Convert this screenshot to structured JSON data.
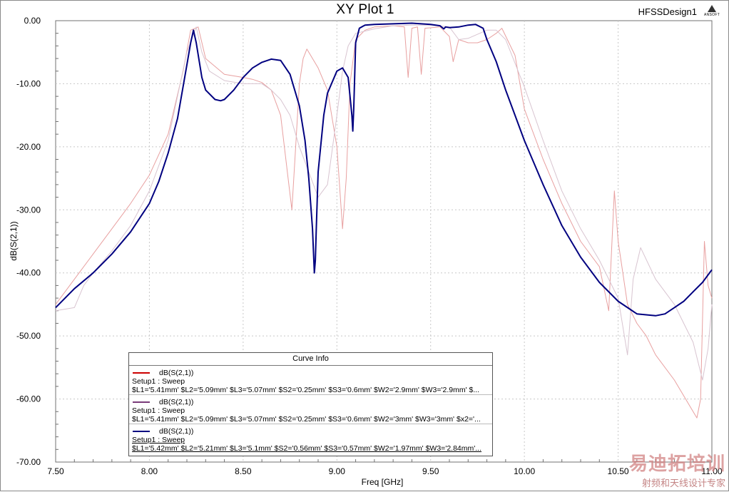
{
  "window": {
    "title": "XY Plot 1",
    "design_name": "HFSSDesign1",
    "logo_text": "ANSOFT"
  },
  "chart_data": {
    "type": "line",
    "title": "XY Plot 1",
    "xlabel": "Freq [GHz]",
    "ylabel": "dB(S(2,1))",
    "xlim": [
      7.5,
      11.0
    ],
    "ylim": [
      -70,
      0
    ],
    "x_ticks": [
      "7.50",
      "8.00",
      "8.50",
      "9.00",
      "9.50",
      "10.00",
      "10.50",
      "11.00"
    ],
    "y_ticks": [
      "0.00",
      "-10.00",
      "-20.00",
      "-30.00",
      "-40.00",
      "-50.00",
      "-60.00",
      "-70.00"
    ],
    "grid": true,
    "legend_title": "Curve Info",
    "legend_placement": "bottom-left",
    "series": [
      {
        "name": "dB(S(2,1))",
        "setup": "Setup1 : Sweep",
        "params": "$L1='5.41mm' $L2='5.09mm' $L3='5.07mm' $S2='0.25mm' $S3='0.6mm' $W2='2.9mm' $W3='2.9mm' $...",
        "color": "#e8a0a0",
        "legend_color": "#cc0000",
        "x": [
          7.5,
          7.6,
          7.7,
          7.8,
          7.9,
          8.0,
          8.1,
          8.18,
          8.22,
          8.26,
          8.3,
          8.4,
          8.5,
          8.55,
          8.6,
          8.65,
          8.7,
          8.74,
          8.76,
          8.78,
          8.8,
          8.82,
          8.84,
          8.86,
          8.9,
          8.95,
          9.0,
          9.03,
          9.05,
          9.07,
          9.1,
          9.15,
          9.2,
          9.3,
          9.36,
          9.38,
          9.4,
          9.43,
          9.45,
          9.47,
          9.55,
          9.6,
          9.62,
          9.65,
          9.7,
          9.75,
          9.8,
          9.85,
          9.88,
          9.95,
          10.0,
          10.1,
          10.2,
          10.3,
          10.4,
          10.45,
          10.48,
          10.5,
          10.55,
          10.6,
          10.65,
          10.7,
          10.8,
          10.9,
          10.92,
          10.94,
          10.96,
          10.98,
          11.0
        ],
        "y": [
          -45.0,
          -41.0,
          -37.0,
          -33.0,
          -29.0,
          -24.5,
          -18.0,
          -8.0,
          -1.5,
          -1.0,
          -6.0,
          -8.5,
          -9.0,
          -9.3,
          -9.8,
          -11.0,
          -15.0,
          -25.0,
          -30.0,
          -20.0,
          -10.0,
          -6.0,
          -4.5,
          -5.5,
          -7.5,
          -11.0,
          -20.0,
          -33.0,
          -25.0,
          -10.0,
          -3.0,
          -1.5,
          -1.0,
          -0.8,
          -1.0,
          -9.0,
          -1.2,
          -1.0,
          -8.5,
          -1.2,
          -1.0,
          -2.5,
          -6.5,
          -3.0,
          -3.5,
          -3.5,
          -3.0,
          -2.0,
          -1.2,
          -5.5,
          -14.0,
          -22.0,
          -29.0,
          -35.0,
          -39.0,
          -46.0,
          -27.0,
          -35.0,
          -45.0,
          -48.0,
          -50.0,
          -53.0,
          -57.0,
          -62.0,
          -63.0,
          -60.0,
          -35.0,
          -42.0,
          -44.0
        ]
      },
      {
        "name": "dB(S(2,1))",
        "setup": "Setup1 : Sweep",
        "params": "$L1='5.41mm' $L2='5.09mm' $L3='5.07mm' $S2='0.25mm' $S3='0.6mm' $W2='3mm' $W3='3mm' $x2='...",
        "color": "#d8c4d0",
        "legend_color": "#7a3b7a",
        "x": [
          7.5,
          7.6,
          7.65,
          7.7,
          7.8,
          7.9,
          8.0,
          8.1,
          8.2,
          8.25,
          8.28,
          8.32,
          8.4,
          8.5,
          8.6,
          8.65,
          8.7,
          8.75,
          8.8,
          8.85,
          8.9,
          8.95,
          9.0,
          9.03,
          9.06,
          9.1,
          9.2,
          9.3,
          9.4,
          9.5,
          9.6,
          9.65,
          9.7,
          9.8,
          9.85,
          9.9,
          10.0,
          10.1,
          10.2,
          10.3,
          10.4,
          10.5,
          10.55,
          10.58,
          10.62,
          10.7,
          10.8,
          10.9,
          10.95,
          10.98,
          11.0
        ],
        "y": [
          -46.0,
          -45.5,
          -42.0,
          -40.0,
          -36.5,
          -32.5,
          -27.0,
          -19.0,
          -5.0,
          -1.0,
          -5.0,
          -8.0,
          -9.5,
          -10.0,
          -10.0,
          -11.0,
          -12.5,
          -15.0,
          -20.0,
          -24.0,
          -28.0,
          -26.0,
          -15.0,
          -8.0,
          -4.0,
          -2.0,
          -1.3,
          -0.8,
          -0.7,
          -0.7,
          -1.0,
          -3.0,
          -2.8,
          -1.5,
          -1.5,
          -3.0,
          -10.5,
          -19.0,
          -27.0,
          -33.0,
          -38.0,
          -44.0,
          -53.0,
          -41.0,
          -36.0,
          -41.0,
          -45.0,
          -51.0,
          -57.0,
          -52.0,
          -45.0
        ]
      },
      {
        "name": "dB(S(2,1))",
        "setup": "Setup1 : Sweep",
        "params": "$L1='5.42mm' $L2='5.21mm' $L3='5.1mm' $S2='0.56mm' $S3='0.57mm' $W2='1.97mm' $W3='2.84mm'...",
        "color": "#000080",
        "legend_color": "#000080",
        "x": [
          7.5,
          7.6,
          7.7,
          7.8,
          7.9,
          8.0,
          8.05,
          8.1,
          8.15,
          8.2,
          8.22,
          8.235,
          8.25,
          8.28,
          8.3,
          8.35,
          8.38,
          8.4,
          8.45,
          8.5,
          8.55,
          8.6,
          8.65,
          8.7,
          8.75,
          8.8,
          8.83,
          8.85,
          8.87,
          8.88,
          8.885,
          8.89,
          8.9,
          8.93,
          8.95,
          9.0,
          9.03,
          9.06,
          9.08,
          9.085,
          9.09,
          9.1,
          9.12,
          9.15,
          9.2,
          9.3,
          9.4,
          9.5,
          9.55,
          9.57,
          9.58,
          9.6,
          9.65,
          9.7,
          9.74,
          9.78,
          9.8,
          9.85,
          9.9,
          9.95,
          10.0,
          10.1,
          10.2,
          10.3,
          10.4,
          10.5,
          10.6,
          10.7,
          10.75,
          10.8,
          10.85,
          10.9,
          10.95,
          11.0
        ],
        "y": [
          -45.5,
          -42.5,
          -40.0,
          -37.0,
          -33.5,
          -29.0,
          -25.5,
          -21.0,
          -15.5,
          -7.0,
          -3.5,
          -1.5,
          -3.5,
          -9.0,
          -11.0,
          -12.5,
          -12.7,
          -12.5,
          -11.0,
          -9.0,
          -7.5,
          -6.6,
          -6.1,
          -6.3,
          -8.5,
          -13.5,
          -19.0,
          -25.0,
          -33.0,
          -40.0,
          -38.0,
          -33.0,
          -24.0,
          -15.0,
          -11.5,
          -8.0,
          -7.5,
          -9.0,
          -15.0,
          -17.5,
          -14.0,
          -3.5,
          -1.2,
          -0.7,
          -0.6,
          -0.5,
          -0.4,
          -0.6,
          -0.8,
          -1.3,
          -1.0,
          -1.1,
          -1.0,
          -0.7,
          -0.6,
          -1.2,
          -3.0,
          -6.5,
          -11.0,
          -15.0,
          -19.0,
          -26.0,
          -32.5,
          -37.5,
          -41.5,
          -44.5,
          -46.5,
          -46.8,
          -46.5,
          -45.5,
          -44.5,
          -43.0,
          -41.5,
          -39.5
        ]
      }
    ]
  },
  "legend": {
    "title": "Curve Info",
    "entries": [
      {
        "name": "dB(S(2,1))",
        "setup": "Setup1 : Sweep",
        "params": "$L1='5.41mm' $L2='5.09mm' $L3='5.07mm' $S2='0.25mm' $S3='0.6mm' $W2='2.9mm' $W3='2.9mm' $..."
      },
      {
        "name": "dB(S(2,1))",
        "setup": "Setup1 : Sweep",
        "params": "$L1='5.41mm' $L2='5.09mm' $L3='5.07mm' $S2='0.25mm' $S3='0.6mm' $W2='3mm' $W3='3mm' $x2='..."
      },
      {
        "name": "dB(S(2,1))",
        "setup": "Setup1 : Sweep",
        "params": "$L1='5.42mm' $L2='5.21mm' $L3='5.1mm' $S2='0.56mm' $S3='0.57mm' $W2='1.97mm' $W3='2.84mm'..."
      }
    ]
  },
  "watermark": {
    "big": "易迪拓培训",
    "small": "射频和天线设计专家"
  }
}
